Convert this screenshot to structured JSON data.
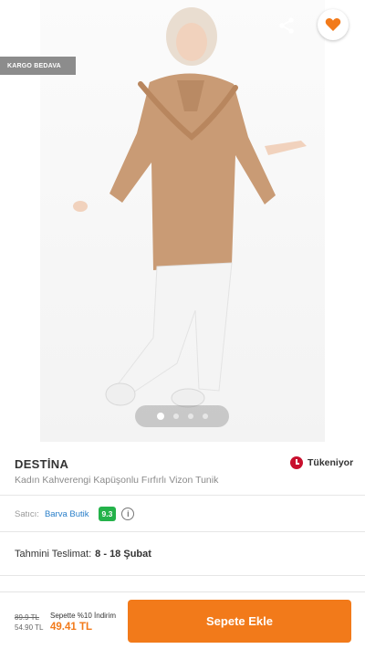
{
  "product_image": {
    "badge": "KARGO BEDAVA",
    "active_slide": 1,
    "slide_count": 4
  },
  "icons": {
    "back": "arrow-left-icon",
    "share": "share-icon",
    "favorite": "heart-icon"
  },
  "colors": {
    "accent": "#f27a1a",
    "seller_score_bg": "#24b24a",
    "stock_warning": "#c8102e",
    "seller_link": "#2a7fc9"
  },
  "product": {
    "brand": "DESTİNA",
    "title": "Kadın Kahverengi Kapüşonlu Fırfırlı Vizon Tunik",
    "stock_status": "Tükeniyor"
  },
  "seller": {
    "label": "Satıcı:",
    "name": "Barva Butik",
    "score": "9.3",
    "info": "i"
  },
  "delivery": {
    "label": "Tahmini Teslimat:",
    "value": "8 - 18 Şubat"
  },
  "pricing": {
    "old_price": "89.9 TL",
    "current_price": "54.90 TL",
    "promo_label": "Sepette %10 İndirim",
    "promo_price": "49.41 TL"
  },
  "actions": {
    "add_to_cart": "Sepete Ekle"
  }
}
